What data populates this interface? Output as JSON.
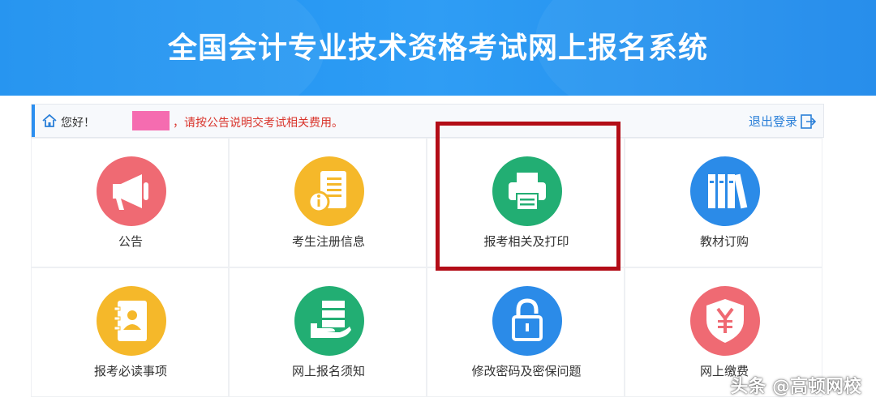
{
  "header": {
    "title": "全国会计专业技术资格考试网上报名系统"
  },
  "notice": {
    "greeting": "您好！",
    "message": "，请按公告说明交考试相关费用。",
    "logout_label": "退出登录"
  },
  "tiles": [
    {
      "label": "公告",
      "icon": "megaphone-icon",
      "color": "#ef6a73"
    },
    {
      "label": "考生注册信息",
      "icon": "info-document-icon",
      "color": "#f5b82a"
    },
    {
      "label": "报考相关及打印",
      "icon": "printer-icon",
      "color": "#22ae73"
    },
    {
      "label": "教材订购",
      "icon": "books-icon",
      "color": "#2b8be8"
    },
    {
      "label": "报考必读事项",
      "icon": "contact-book-icon",
      "color": "#f5b82a"
    },
    {
      "label": "网上报名须知",
      "icon": "server-hand-icon",
      "color": "#22ae73"
    },
    {
      "label": "修改密码及密保问题",
      "icon": "padlock-icon",
      "color": "#2b8be8"
    },
    {
      "label": "网上缴费",
      "icon": "yen-shield-icon",
      "color": "#ef6a73"
    }
  ],
  "highlight_color": "#b30d17",
  "watermark": "头条 @高顿网校"
}
